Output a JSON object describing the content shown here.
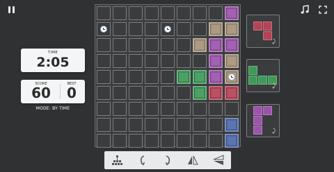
{
  "header": {
    "pause_icon": "pause-icon",
    "music_icon": "music-note-icon",
    "fullscreen_icon": "fullscreen-icon"
  },
  "time_panel": {
    "label": "TIME",
    "value": "2:05"
  },
  "score_panel": {
    "score_label": "SCORE",
    "score_value": "60",
    "best_label": "BEST",
    "best_value": "0"
  },
  "mode_text": "MODE: BY TIME",
  "board": {
    "cols": 9,
    "rows": 9,
    "blocks": [
      {
        "col": 8,
        "row": 0,
        "color": "#9c54ab"
      },
      {
        "col": 7,
        "row": 1,
        "color": "#a6927b"
      },
      {
        "col": 8,
        "row": 1,
        "color": "#a6927b"
      },
      {
        "col": 6,
        "row": 2,
        "color": "#a6927b"
      },
      {
        "col": 7,
        "row": 2,
        "color": "#9c54ab"
      },
      {
        "col": 8,
        "row": 2,
        "color": "#9c54ab"
      },
      {
        "col": 7,
        "row": 3,
        "color": "#9c54ab"
      },
      {
        "col": 8,
        "row": 3,
        "color": "#a6927b"
      },
      {
        "col": 5,
        "row": 4,
        "color": "#3f9a5a"
      },
      {
        "col": 6,
        "row": 4,
        "color": "#3f9a5a"
      },
      {
        "col": 7,
        "row": 4,
        "color": "#9c54ab"
      },
      {
        "col": 8,
        "row": 4,
        "color": "#a6927b"
      },
      {
        "col": 6,
        "row": 5,
        "color": "#3f9a5a"
      },
      {
        "col": 7,
        "row": 5,
        "color": "#b34456"
      },
      {
        "col": 8,
        "row": 5,
        "color": "#b34456"
      },
      {
        "col": 8,
        "row": 7,
        "color": "#4f6aa8"
      },
      {
        "col": 8,
        "row": 8,
        "color": "#4f6aa8"
      }
    ],
    "clocks": [
      {
        "col": 0,
        "row": 1
      },
      {
        "col": 4,
        "row": 1
      },
      {
        "col": 8,
        "row": 4
      }
    ]
  },
  "previews": [
    {
      "name": "preview-piece-1",
      "color": "#b34456",
      "cells": [
        [
          0,
          0
        ],
        [
          1,
          0
        ],
        [
          1,
          1
        ]
      ],
      "rotation": "⤸"
    },
    {
      "name": "preview-piece-2",
      "color": "#3f9a5a",
      "cells": [
        [
          0,
          0
        ],
        [
          0,
          1
        ],
        [
          1,
          1
        ],
        [
          2,
          1
        ]
      ],
      "rotation": "⤸"
    },
    {
      "name": "preview-piece-3",
      "color": "#9c54ab",
      "cells": [
        [
          0,
          0
        ],
        [
          1,
          0
        ],
        [
          0,
          1
        ],
        [
          0,
          2
        ]
      ],
      "rotation": "⤸"
    }
  ],
  "toolbar": {
    "buttons": [
      {
        "name": "stack-button",
        "icon": "stack-icon"
      },
      {
        "name": "rotate-left-button",
        "icon": "rotate-left-icon"
      },
      {
        "name": "rotate-right-button",
        "icon": "rotate-right-icon"
      },
      {
        "name": "flip-vertical-button",
        "icon": "flip-vertical-icon"
      },
      {
        "name": "flip-horizontal-button",
        "icon": "flip-horizontal-icon"
      }
    ]
  }
}
